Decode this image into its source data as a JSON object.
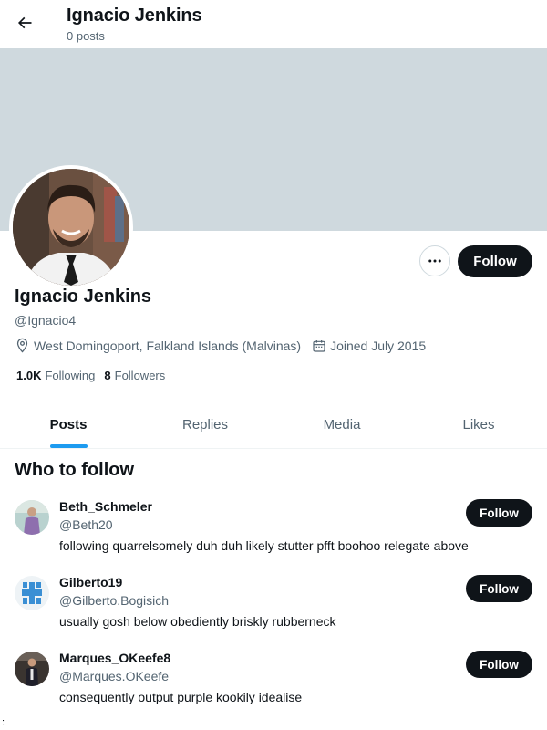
{
  "header": {
    "title": "Ignacio Jenkins",
    "post_count": "0 posts",
    "back_icon": "arrow-left-icon"
  },
  "profile": {
    "name": "Ignacio Jenkins",
    "handle": "@Ignacio4",
    "location": "West Domingoport, Falkland Islands (Malvinas)",
    "joined": "Joined July 2015",
    "following_count": "1.0K",
    "following_label": "Following",
    "followers_count": "8",
    "followers_label": "Followers",
    "follow_label": "Follow",
    "more_icon": "more-icon",
    "banner_color": "#cfd9de"
  },
  "tabs": [
    {
      "label": "Posts",
      "active": true
    },
    {
      "label": "Replies",
      "active": false
    },
    {
      "label": "Media",
      "active": false
    },
    {
      "label": "Likes",
      "active": false
    }
  ],
  "who_to_follow": {
    "title": "Who to follow",
    "suggestions": [
      {
        "name": "Beth_Schmeler",
        "handle": "@Beth20",
        "bio": "following quarrelsomely duh duh likely stutter pfft boohoo relegate above",
        "follow_label": "Follow"
      },
      {
        "name": "Gilberto19",
        "handle": "@Gilberto.Bogisich",
        "bio": "usually gosh below obediently briskly rubberneck",
        "follow_label": "Follow"
      },
      {
        "name": "Marques_OKeefe8",
        "handle": "@Marques.OKeefe",
        "bio": "consequently output purple kookily idealise",
        "follow_label": "Follow"
      }
    ]
  },
  "footer_glyph": ":",
  "colors": {
    "accent": "#1d9bf0",
    "button_dark": "#0f1419",
    "secondary_text": "#536471"
  }
}
